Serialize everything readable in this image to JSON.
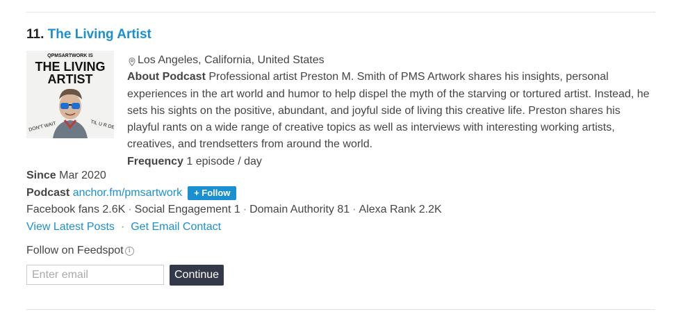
{
  "listing": {
    "rank": "11.",
    "title": "The Living Artist",
    "thumbnail": {
      "brand": "QPMSARTWORK IS",
      "title_line1": "THE LIVING",
      "title_line2": "ARTIST",
      "tagline_left": "DON'T WAIT",
      "tagline_right": "TIL U R DEAD"
    },
    "location": "Los Angeles, California, United States",
    "about_label": "About Podcast",
    "about_text": "Professional artist Preston M. Smith of PMS Artwork shares his insights, personal experiences in the art world and humor to help dispel the myth of the starving or tortured artist. Instead, he sets his sights on the positive, abundant, and joyful side of living this creative life. Preston shares his playful rants on a wide range of creative topics as well as interviews with interesting working artists, creatives, and trendsetters from around the world.",
    "frequency_label": "Frequency",
    "frequency_value": "1 episode / day",
    "since_label": "Since",
    "since_value": "Mar 2020",
    "podcast_label": "Podcast",
    "podcast_link": "anchor.fm/pmsartwork",
    "follow_button": "+ Follow",
    "stats": {
      "facebook_fans": "Facebook fans 2.6K",
      "social_engagement": "Social Engagement 1",
      "domain_authority": "Domain Authority 81",
      "alexa_rank": "Alexa Rank 2.2K",
      "separator": "·"
    },
    "links": {
      "latest_posts": "View Latest Posts",
      "email_contact": "Get Email Contact",
      "separator": "·"
    }
  },
  "follow_form": {
    "label": "Follow on Feedspot",
    "info_icon": "i",
    "email_placeholder": "Enter email",
    "continue_button": "Continue"
  },
  "colors": {
    "link": "#1a8fd1",
    "button_dark": "#34394a",
    "text": "#444444"
  },
  "icons": {
    "location": "map-pin-icon",
    "info": "info-icon"
  }
}
